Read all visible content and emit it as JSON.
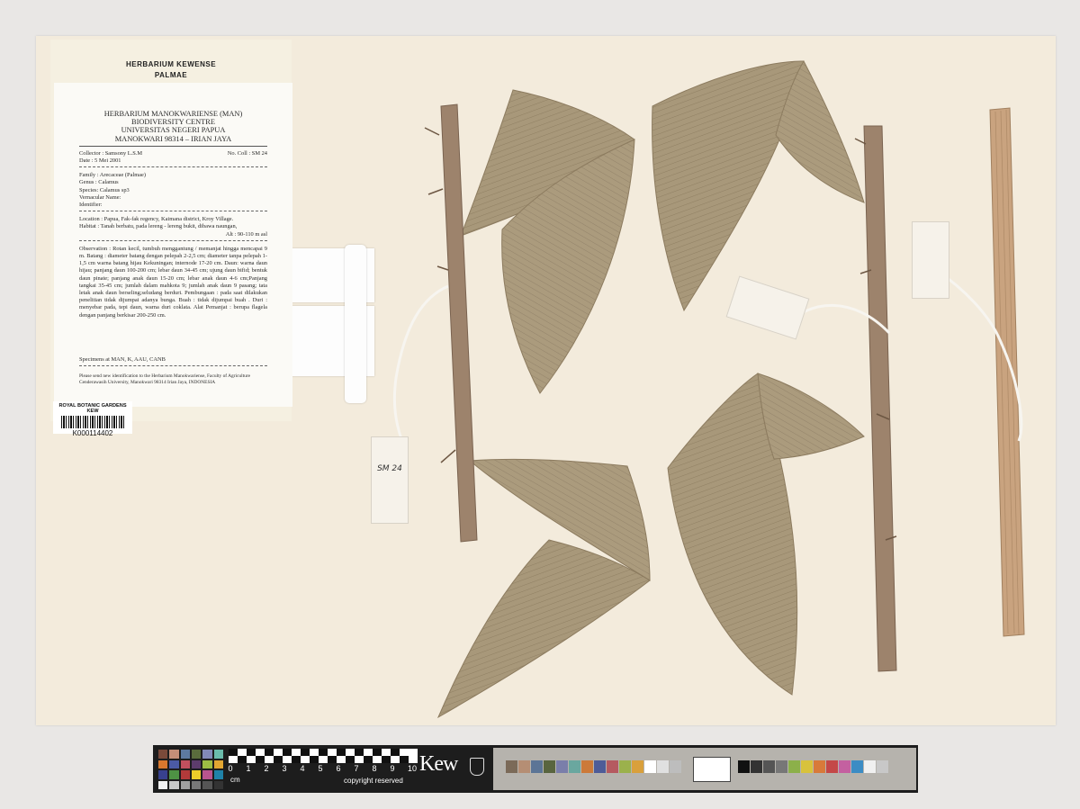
{
  "kew_label": {
    "line1": "HERBARIUM  KEWENSE",
    "line2": "PALMAE"
  },
  "man_label": {
    "header": [
      "HERBARIUM MANOKWARIENSE (MAN)",
      "BIODIVERSITY CENTRE",
      "UNIVERSITAS NEGERI PAPUA",
      "MANOKWARI 98314 – IRIAN JAYA"
    ],
    "collector": "Collector : Samsony L.S.M",
    "coll_no": "No. Coll : SM  24",
    "date": "Date : 5 Mei 2001",
    "family": "Family : Arecaceae (Palmae)",
    "genus": "Genus : Calamus",
    "species": "Species: Calamus sp3",
    "vernacular": "Vernacular Name:",
    "identifier": "Identifier:",
    "location": "Location : Papua, Fak-fak regency, Kaimana district, Kroy Village.",
    "habitat": "Habitat : Tanah berbatu, pada lereng - lereng bukit, dibawa naungan,",
    "alt": "Alt : 90-110 m asl",
    "observation": "Observation : Rotan kecil, tumbuh menggantung / memanjat hingga mencapai 9 m. Batang : diameter batang dengan pelepah 2-2,5 cm; diameter tanpa pelepah 1-1,5 cm warna batang hijau Kekuningan; internode 17-20 cm. Daun: warna daun hijau; panjang daun 100-200 cm; lebar daun 34-45 cm; ujung daun bifid; bentuk daun pinate; panjang anak daun 15-20 cm; lebar anak daun 4-6 cm;Panjang tangkai 35-45 cm; jumlah dalam mahkota 9; jumlah anak daun 9 pasang; tata letak anak daun berseling;seludang berduri. Pembungaan : pada saat dilakukan penelitian tidak dijumpai adanya bunga. Buah : tidak dijumpai buah . Duri : menyebar pada, tepi daun, warna duri coklata. Alat Pemanjat : berupa flagela dengan panjang berkisar 200-250 cm.",
    "specimens": "Specimens at MAN, K, AAU, CANB",
    "note": "Please send new identification to the Herbarium Manokwariense, Faculty of Agriculture Cenderawasih University, Manokwari 98314 Irian Jaya, INDONESIA"
  },
  "barcode": {
    "institution": "ROYAL BOTANIC GARDENS KEW",
    "number": "K000114402"
  },
  "tag_text": "SM 24",
  "scale": {
    "ruler_numbers": [
      "0",
      "1",
      "2",
      "3",
      "4",
      "5",
      "6",
      "7",
      "8",
      "9",
      "10"
    ],
    "unit": "cm",
    "copyright": "copyright reserved",
    "logo": "Kew"
  },
  "colors": {
    "sheet": "#f3ebdc",
    "leaf": "#a8987a",
    "stem": "#9d836c",
    "background": "#e9e7e5"
  }
}
